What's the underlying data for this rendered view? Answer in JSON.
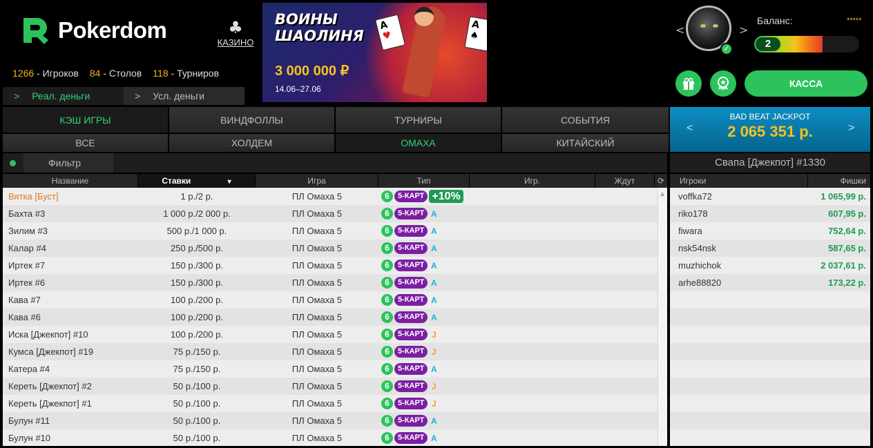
{
  "brand": {
    "name": "Pokerdom"
  },
  "casino": {
    "label": "КАЗИНО"
  },
  "stats": {
    "players_num": "1266",
    "players_lbl": " - Игроков",
    "tables_num": "84",
    "tables_lbl": " - Столов",
    "tourn_num": "118",
    "tourn_lbl": " - Турниров"
  },
  "money_tabs": [
    {
      "arrow": ">",
      "label": "Реал. деньги"
    },
    {
      "arrow": ">",
      "label": "Усл. деньги"
    }
  ],
  "banner": {
    "title": "ВОИНЫ\nШАОЛИНЯ",
    "amount": "3 000 000 ₽",
    "dates": "14.06–27.06"
  },
  "profile": {
    "balance_label": "Баланс:",
    "balance_value": "*****",
    "level": "2",
    "level_progress": 0.65,
    "prev_arrow": "<",
    "next_arrow": ">"
  },
  "buttons": {
    "cashier": "КАССА"
  },
  "main_tabs": [
    "КЭШ ИГРЫ",
    "ВИНДФОЛЛЫ",
    "ТУРНИРЫ",
    "СОБЫТИЯ"
  ],
  "sub_tabs": [
    "ВСЕ",
    "ХОЛДЕМ",
    "ОМАХА",
    "КИТАЙСКИЙ"
  ],
  "jackpot": {
    "title": "BAD BEAT JACKPOT",
    "value": "2 065 351 р.",
    "prev": "<",
    "next": ">"
  },
  "filter": {
    "label": "Фильтр"
  },
  "table_detail": {
    "title": "Свапа [Джекпот] #1330"
  },
  "columns": {
    "name": "Название",
    "stakes": "Ставки",
    "sort_arrow": "▾",
    "game": "Игра",
    "type": "Тип",
    "players": "Игр.",
    "waiting": "Ждут"
  },
  "player_columns": {
    "player": "Игроки",
    "chips": "Фишки"
  },
  "tables": [
    {
      "name": "Вятка [Буст]",
      "stakes": "1 р./2 р.",
      "game": "ПЛ Омаха 5",
      "seats": "6",
      "cards": "5-КАРТ",
      "tag": "+10%",
      "tag_kind": "pct",
      "boost": true
    },
    {
      "name": "Бахта #3",
      "stakes": "1 000 р./2 000 р.",
      "game": "ПЛ Омаха 5",
      "seats": "6",
      "cards": "5-КАРТ",
      "tag": "A",
      "tag_kind": "A"
    },
    {
      "name": "Зилим #3",
      "stakes": "500 р./1 000 р.",
      "game": "ПЛ Омаха 5",
      "seats": "6",
      "cards": "5-КАРТ",
      "tag": "A",
      "tag_kind": "A"
    },
    {
      "name": "Калар #4",
      "stakes": "250 р./500 р.",
      "game": "ПЛ Омаха 5",
      "seats": "6",
      "cards": "5-КАРТ",
      "tag": "A",
      "tag_kind": "A"
    },
    {
      "name": "Иртек #7",
      "stakes": "150 р./300 р.",
      "game": "ПЛ Омаха 5",
      "seats": "6",
      "cards": "5-КАРТ",
      "tag": "A",
      "tag_kind": "A"
    },
    {
      "name": "Иртек #6",
      "stakes": "150 р./300 р.",
      "game": "ПЛ Омаха 5",
      "seats": "6",
      "cards": "5-КАРТ",
      "tag": "A",
      "tag_kind": "A"
    },
    {
      "name": "Кава #7",
      "stakes": "100 р./200 р.",
      "game": "ПЛ Омаха 5",
      "seats": "6",
      "cards": "5-КАРТ",
      "tag": "A",
      "tag_kind": "A"
    },
    {
      "name": "Кава #6",
      "stakes": "100 р./200 р.",
      "game": "ПЛ Омаха 5",
      "seats": "6",
      "cards": "5-КАРТ",
      "tag": "A",
      "tag_kind": "A"
    },
    {
      "name": "Иска [Джекпот] #10",
      "stakes": "100 р./200 р.",
      "game": "ПЛ Омаха 5",
      "seats": "6",
      "cards": "5-КАРТ",
      "tag": "J",
      "tag_kind": "J"
    },
    {
      "name": "Кумса [Джекпот] #19",
      "stakes": "75 р./150 р.",
      "game": "ПЛ Омаха 5",
      "seats": "6",
      "cards": "5-КАРТ",
      "tag": "J",
      "tag_kind": "J"
    },
    {
      "name": "Катера #4",
      "stakes": "75 р./150 р.",
      "game": "ПЛ Омаха 5",
      "seats": "6",
      "cards": "5-КАРТ",
      "tag": "A",
      "tag_kind": "A"
    },
    {
      "name": "Кереть [Джекпот] #2",
      "stakes": "50 р./100 р.",
      "game": "ПЛ Омаха 5",
      "seats": "6",
      "cards": "5-КАРТ",
      "tag": "J",
      "tag_kind": "J"
    },
    {
      "name": "Кереть [Джекпот] #1",
      "stakes": "50 р./100 р.",
      "game": "ПЛ Омаха 5",
      "seats": "6",
      "cards": "5-КАРТ",
      "tag": "J",
      "tag_kind": "J"
    },
    {
      "name": "Булун #11",
      "stakes": "50 р./100 р.",
      "game": "ПЛ Омаха 5",
      "seats": "6",
      "cards": "5-КАРТ",
      "tag": "A",
      "tag_kind": "A"
    },
    {
      "name": "Булун #10",
      "stakes": "50 р./100 р.",
      "game": "ПЛ Омаха 5",
      "seats": "6",
      "cards": "5-КАРТ",
      "tag": "A",
      "tag_kind": "A"
    }
  ],
  "players": [
    {
      "name": "voffka72",
      "chips": "1 065,99 р."
    },
    {
      "name": "riko178",
      "chips": "607,95 р."
    },
    {
      "name": "fiwara",
      "chips": "752,64 р."
    },
    {
      "name": "nsk54nsk",
      "chips": "587,65 р."
    },
    {
      "name": "muzhichok",
      "chips": "2 037,61 р."
    },
    {
      "name": "arhe88820",
      "chips": "173,22 р."
    }
  ],
  "colors": {
    "accent_green": "#2cc35c",
    "gold": "#f5b01b",
    "purple": "#7b1fa2",
    "jackpot_blue": "#0d8ec2"
  }
}
